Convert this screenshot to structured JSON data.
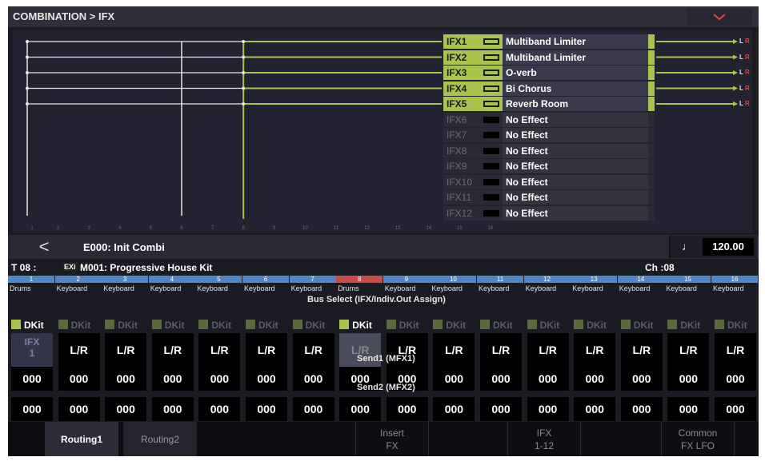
{
  "title": "COMBINATION > IFX",
  "menu_icon": "chevron-down-icon",
  "routing": {
    "timbre_numbers": [
      "1",
      "2",
      "3",
      "4",
      "5",
      "6",
      "7",
      "8",
      "9",
      "10",
      "11",
      "12",
      "13",
      "14",
      "15",
      "16"
    ],
    "ifx": [
      {
        "label": "IFX1",
        "name": "Multiband Limiter",
        "active": true
      },
      {
        "label": "IFX2",
        "name": "Multiband Limiter",
        "active": true
      },
      {
        "label": "IFX3",
        "name": "O-verb",
        "active": true
      },
      {
        "label": "IFX4",
        "name": "Bi Chorus",
        "active": true
      },
      {
        "label": "IFX5",
        "name": "Reverb Room",
        "active": true
      },
      {
        "label": "IFX6",
        "name": "No Effect",
        "active": false
      },
      {
        "label": "IFX7",
        "name": "No Effect",
        "active": false
      },
      {
        "label": "IFX8",
        "name": "No Effect",
        "active": false
      },
      {
        "label": "IFX9",
        "name": "No Effect",
        "active": false
      },
      {
        "label": "IFX10",
        "name": "No Effect",
        "active": false
      },
      {
        "label": "IFX11",
        "name": "No Effect",
        "active": false
      },
      {
        "label": "IFX12",
        "name": "No Effect",
        "active": false
      }
    ],
    "out_l": "L",
    "out_r": "R"
  },
  "combi": {
    "back_symbol": "<",
    "name": "E000: Init Combi",
    "tempo_symbol": "♩",
    "tempo": "120.00"
  },
  "track": {
    "timbre": "T 08 :",
    "exi": "EXi",
    "program": "M001: Progressive House Kit",
    "channel": "Ch :08"
  },
  "section_titles": {
    "bus": "Bus Select (IFX/Indiv.Out Assign)",
    "send1": "Send1 (MFX1)",
    "send2": "Send2 (MFX2)"
  },
  "timbres": [
    {
      "num": "1",
      "type": "Drums",
      "dkit": "DKit",
      "dkit_on": true,
      "bus": "IFX\n1",
      "bus_kind": "ifx",
      "send1": "000",
      "send2": "000"
    },
    {
      "num": "2",
      "type": "Keyboard",
      "dkit": "DKit",
      "dkit_on": false,
      "bus": "L/R",
      "bus_kind": "lr",
      "send1": "000",
      "send2": "000"
    },
    {
      "num": "3",
      "type": "Keyboard",
      "dkit": "DKit",
      "dkit_on": false,
      "bus": "L/R",
      "bus_kind": "lr",
      "send1": "000",
      "send2": "000"
    },
    {
      "num": "4",
      "type": "Keyboard",
      "dkit": "DKit",
      "dkit_on": false,
      "bus": "L/R",
      "bus_kind": "lr",
      "send1": "000",
      "send2": "000"
    },
    {
      "num": "5",
      "type": "Keyboard",
      "dkit": "DKit",
      "dkit_on": false,
      "bus": "L/R",
      "bus_kind": "lr",
      "send1": "000",
      "send2": "000"
    },
    {
      "num": "6",
      "type": "Keyboard",
      "dkit": "DKit",
      "dkit_on": false,
      "bus": "L/R",
      "bus_kind": "lr",
      "send1": "000",
      "send2": "000"
    },
    {
      "num": "7",
      "type": "Keyboard",
      "dkit": "DKit",
      "dkit_on": false,
      "bus": "L/R",
      "bus_kind": "lr",
      "send1": "000",
      "send2": "000"
    },
    {
      "num": "8",
      "type": "Drums",
      "dkit": "DKit",
      "dkit_on": true,
      "bus": "L/R",
      "bus_kind": "dim",
      "send1": "000",
      "send2": "000"
    },
    {
      "num": "9",
      "type": "Keyboard",
      "dkit": "DKit",
      "dkit_on": false,
      "bus": "L/R",
      "bus_kind": "lr",
      "send1": "000",
      "send2": "000"
    },
    {
      "num": "10",
      "type": "Keyboard",
      "dkit": "DKit",
      "dkit_on": false,
      "bus": "L/R",
      "bus_kind": "lr",
      "send1": "000",
      "send2": "000"
    },
    {
      "num": "11",
      "type": "Keyboard",
      "dkit": "DKit",
      "dkit_on": false,
      "bus": "L/R",
      "bus_kind": "lr",
      "send1": "000",
      "send2": "000"
    },
    {
      "num": "12",
      "type": "Keyboard",
      "dkit": "DKit",
      "dkit_on": false,
      "bus": "L/R",
      "bus_kind": "lr",
      "send1": "000",
      "send2": "000"
    },
    {
      "num": "13",
      "type": "Keyboard",
      "dkit": "DKit",
      "dkit_on": false,
      "bus": "L/R",
      "bus_kind": "lr",
      "send1": "000",
      "send2": "000"
    },
    {
      "num": "14",
      "type": "Keyboard",
      "dkit": "DKit",
      "dkit_on": false,
      "bus": "L/R",
      "bus_kind": "lr",
      "send1": "000",
      "send2": "000"
    },
    {
      "num": "15",
      "type": "Keyboard",
      "dkit": "DKit",
      "dkit_on": false,
      "bus": "L/R",
      "bus_kind": "lr",
      "send1": "000",
      "send2": "000"
    },
    {
      "num": "16",
      "type": "Keyboard",
      "dkit": "DKit",
      "dkit_on": false,
      "bus": "L/R",
      "bus_kind": "lr",
      "send1": "000",
      "send2": "000"
    }
  ],
  "tabs": [
    {
      "label": "Routing1",
      "state": "active"
    },
    {
      "label": "Routing2",
      "state": "inactive"
    },
    {
      "label": "Insert\nFX",
      "state": "gray"
    },
    {
      "label": "IFX\n1-12",
      "state": "gray"
    },
    {
      "label": "Common\nFX LFO",
      "state": "gray"
    }
  ],
  "colors": {
    "accent_green": "#a9c44c",
    "timbre_blue": "#4f86c6",
    "timbre_selected_red": "#c84b46",
    "out_r_red": "#e0463e"
  }
}
